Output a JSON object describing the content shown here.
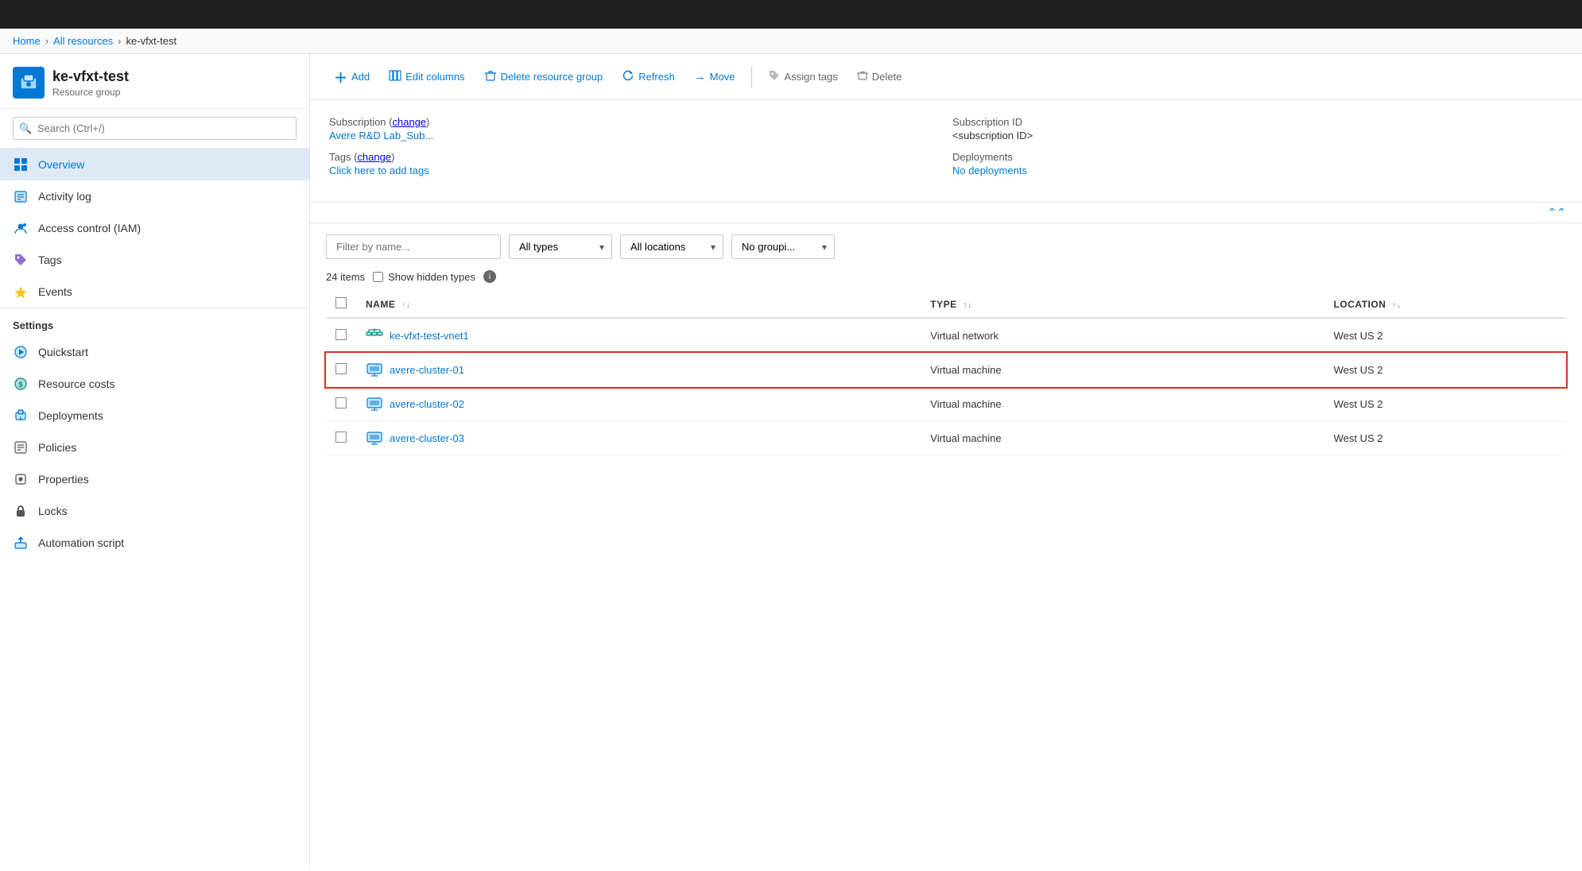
{
  "topbar": {},
  "breadcrumb": {
    "home": "Home",
    "allresources": "All resources",
    "current": "ke-vfxt-test"
  },
  "sidebar": {
    "resource_name": "ke-vfxt-test",
    "resource_type": "Resource group",
    "search_placeholder": "Search (Ctrl+/)",
    "nav_items": [
      {
        "id": "overview",
        "label": "Overview",
        "active": true
      },
      {
        "id": "activity-log",
        "label": "Activity log",
        "active": false
      },
      {
        "id": "access-control",
        "label": "Access control (IAM)",
        "active": false
      },
      {
        "id": "tags",
        "label": "Tags",
        "active": false
      },
      {
        "id": "events",
        "label": "Events",
        "active": false
      }
    ],
    "settings_label": "Settings",
    "settings_items": [
      {
        "id": "quickstart",
        "label": "Quickstart"
      },
      {
        "id": "resource-costs",
        "label": "Resource costs"
      },
      {
        "id": "deployments",
        "label": "Deployments"
      },
      {
        "id": "policies",
        "label": "Policies"
      },
      {
        "id": "properties",
        "label": "Properties"
      },
      {
        "id": "locks",
        "label": "Locks"
      },
      {
        "id": "automation-script",
        "label": "Automation script"
      }
    ]
  },
  "toolbar": {
    "add_label": "Add",
    "edit_columns_label": "Edit columns",
    "delete_rg_label": "Delete resource group",
    "refresh_label": "Refresh",
    "move_label": "Move",
    "assign_tags_label": "Assign tags",
    "delete_label": "Delete"
  },
  "info_panel": {
    "subscription_label": "Subscription",
    "subscription_change": "change",
    "subscription_value": "Avere R&D Lab_Sub...",
    "subscription_id_label": "Subscription ID",
    "subscription_id_value": "<subscription ID>",
    "deployments_label": "Deployments",
    "deployments_value": "No deployments",
    "tags_label": "Tags",
    "tags_change": "change",
    "tags_add": "Click here to add tags"
  },
  "filters": {
    "name_placeholder": "Filter by name...",
    "type_label": "All types",
    "location_label": "All locations",
    "grouping_label": "No groupi..."
  },
  "resources_list": {
    "item_count": "24 items",
    "show_hidden_label": "Show hidden types",
    "col_name": "NAME",
    "col_type": "TYPE",
    "col_location": "LOCATION",
    "items": [
      {
        "name": "ke-vfxt-test-vnet1",
        "type": "Virtual network",
        "location": "West US 2",
        "highlighted": false,
        "icon": "vnet"
      },
      {
        "name": "avere-cluster-01",
        "type": "Virtual machine",
        "location": "West US 2",
        "highlighted": true,
        "icon": "vm"
      },
      {
        "name": "avere-cluster-02",
        "type": "Virtual machine",
        "location": "West US 2",
        "highlighted": false,
        "icon": "vm"
      },
      {
        "name": "avere-cluster-03",
        "type": "Virtual machine",
        "location": "West US 2",
        "highlighted": false,
        "icon": "vm"
      }
    ]
  }
}
